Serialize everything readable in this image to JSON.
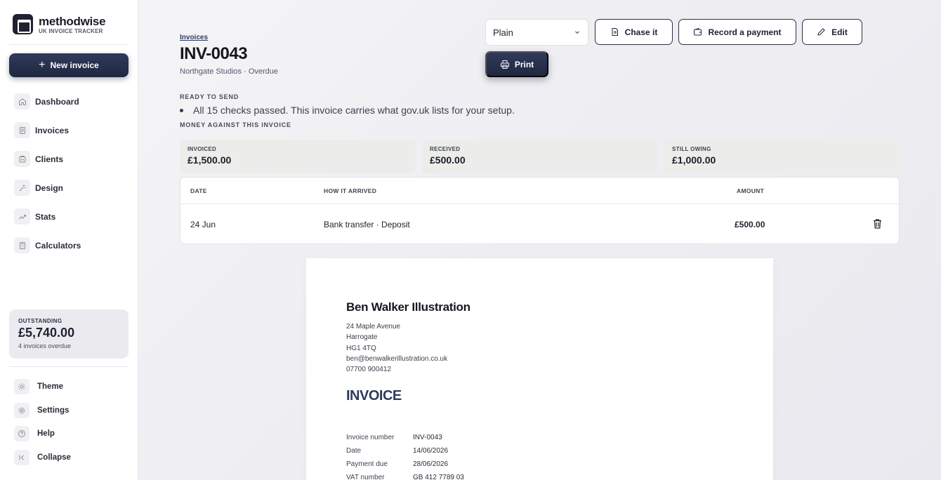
{
  "brand": {
    "name": "methodwise",
    "subtitle": "UK INVOICE TRACKER"
  },
  "sidebar": {
    "new_invoice_label": "New invoice",
    "nav": [
      {
        "label": "Dashboard",
        "icon": "home-icon"
      },
      {
        "label": "Invoices",
        "icon": "document-icon"
      },
      {
        "label": "Clients",
        "icon": "clients-icon"
      },
      {
        "label": "Design",
        "icon": "wand-icon"
      },
      {
        "label": "Stats",
        "icon": "trend-icon"
      },
      {
        "label": "Calculators",
        "icon": "calculator-icon"
      }
    ],
    "outstanding": {
      "label": "OUTSTANDING",
      "amount": "£5,740.00",
      "sub": "4 invoices overdue"
    },
    "bottom": [
      {
        "label": "Theme",
        "icon": "sun-icon"
      },
      {
        "label": "Settings",
        "icon": "gear-icon"
      },
      {
        "label": "Help",
        "icon": "help-icon"
      },
      {
        "label": "Collapse",
        "icon": "collapse-icon"
      }
    ]
  },
  "header": {
    "breadcrumb": "Invoices",
    "title": "INV-0043",
    "subtitle": "Northgate Studios · Overdue",
    "template_select": "Plain",
    "chase_label": "Chase it",
    "record_payment_label": "Record a payment",
    "edit_label": "Edit",
    "print_label": "Print"
  },
  "ready": {
    "label": "READY TO SEND",
    "message": "All 15 checks passed. This invoice carries what gov.uk lists for your setup."
  },
  "money": {
    "label": "MONEY AGAINST THIS INVOICE",
    "cards": [
      {
        "label": "INVOICED",
        "value": "£1,500.00"
      },
      {
        "label": "RECEIVED",
        "value": "£500.00"
      },
      {
        "label": "STILL OWING",
        "value": "£1,000.00"
      }
    ]
  },
  "payments": {
    "headers": {
      "date": "DATE",
      "method": "HOW IT ARRIVED",
      "amount": "AMOUNT"
    },
    "rows": [
      {
        "date": "24 Jun",
        "method": "Bank transfer · Deposit",
        "amount": "£500.00"
      }
    ]
  },
  "invoice_preview": {
    "business_name": "Ben Walker Illustration",
    "address_lines": [
      "24 Maple Avenue",
      "Harrogate",
      "HG1 4TQ",
      "ben@benwalkerillustration.co.uk",
      "07700 900412"
    ],
    "heading": "INVOICE",
    "meta": [
      {
        "key": "Invoice number",
        "value": "INV-0043"
      },
      {
        "key": "Date",
        "value": "14/06/2026"
      },
      {
        "key": "Payment due",
        "value": "28/06/2026"
      },
      {
        "key": "VAT number",
        "value": "GB 412 7789 03"
      }
    ]
  },
  "colors": {
    "accent": "#2f3a5c",
    "sidebar_bg": "#ffffff",
    "card_bg": "#ecedea"
  }
}
